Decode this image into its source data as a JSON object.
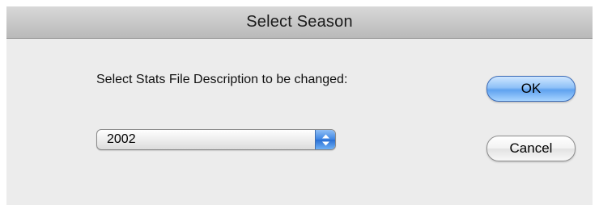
{
  "window": {
    "title": "Select Season"
  },
  "dialog": {
    "prompt": "Select Stats File Description to be changed:",
    "season_select": {
      "selected_value": "2002",
      "icon": "up-down-arrows-icon"
    },
    "ok_label": "OK",
    "cancel_label": "Cancel"
  },
  "colors": {
    "default_button_accent": "#5fa2ef",
    "popup_arrow_accent": "#3b84e3"
  }
}
